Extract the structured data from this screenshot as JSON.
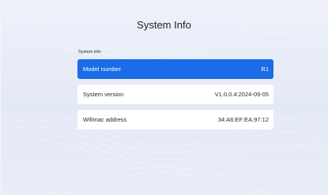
{
  "page": {
    "title": "System Info",
    "section_label": "System info"
  },
  "rows": [
    {
      "label": "Model number",
      "value": "R1",
      "selected": true
    },
    {
      "label": "System version",
      "value": "V1.0.0.4:2024-09-05",
      "selected": false
    },
    {
      "label": "Wifimac address",
      "value": "34:A6:EF:EA:97:12",
      "selected": false
    }
  ],
  "colors": {
    "accent": "#1a6ce8",
    "background": "#e7ecf8",
    "row_background": "#ffffff"
  }
}
